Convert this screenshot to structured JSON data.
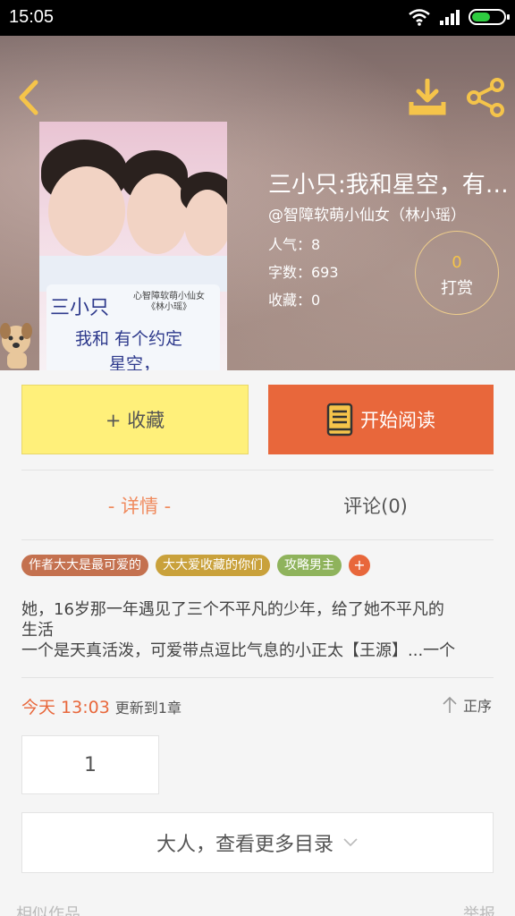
{
  "status_bar": {
    "time": "15:05"
  },
  "book": {
    "title": "三小只:我和星空，有个约定",
    "author": "@智障软萌小仙女（林小瑶）",
    "popularity": "人气：8",
    "word_count": "字数：693",
    "favorites": "收藏：0",
    "tip_count": "0",
    "tip_label": "打赏"
  },
  "cover": {
    "line1": "三小只",
    "line2": "我和  有个约定",
    "line3": "星空，",
    "author_note": "心智障软萌小仙女 《林小瑶》"
  },
  "actions": {
    "collect_label": "+ 收藏",
    "read_label": "开始阅读"
  },
  "tabs": {
    "detail": "- 详情 -",
    "comments": "评论(0)"
  },
  "tags": [
    {
      "label": "作者大大是最可爱的",
      "color": "#c4714f"
    },
    {
      "label": "大大爱收藏的你们",
      "color": "#c9a13b"
    },
    {
      "label": "攻略男主",
      "color": "#8fb35c"
    }
  ],
  "tag_add": "+",
  "description": [
    "她，16岁那一年遇见了三个不平凡的少年，给了她不平凡的",
    "生活",
    "一个是天真活泼，可爱带点逗比气息的小正太【王源】...一个"
  ],
  "update": {
    "time": "今天 13:03",
    "text": "更新到1章"
  },
  "sort_label": "正序",
  "chapter_page": "1",
  "more_catalog": "大人，查看更多目录",
  "footer": {
    "left": "相似作品",
    "right": "举报"
  },
  "colors": {
    "accent": "#e8673b",
    "collect_bg": "#fff07a",
    "icon_yellow": "#f5c44a"
  }
}
